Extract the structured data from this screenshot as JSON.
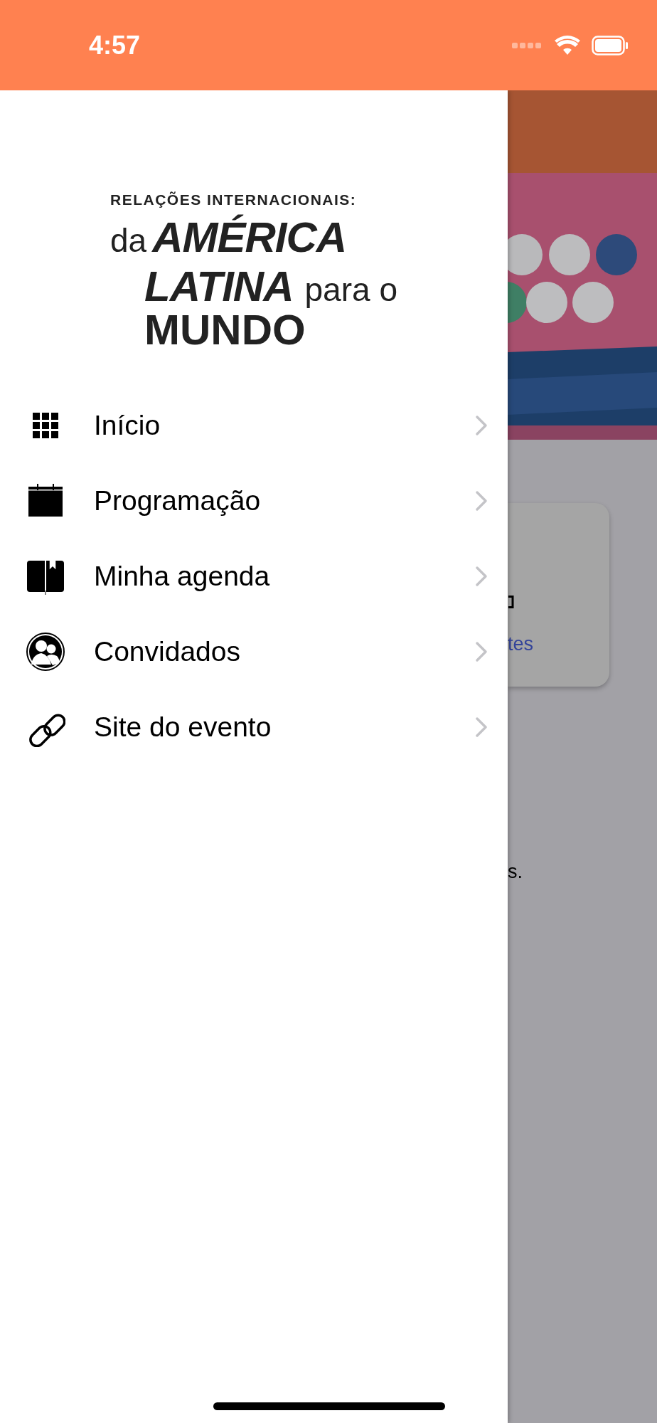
{
  "status_bar": {
    "time": "4:57"
  },
  "drawer": {
    "logo": {
      "line_1": "RELAÇÕES INTERNACIONAIS:",
      "line_2_prefix": "da",
      "line_2": "AMÉRICA",
      "line_3": "LATINA",
      "line_3_suffix": "para o",
      "line_4": "MUNDO"
    },
    "menu": [
      {
        "label": "Início",
        "kind": "grid"
      },
      {
        "label": "Programação",
        "kind": "calendar"
      },
      {
        "label": "Minha agenda",
        "kind": "book"
      },
      {
        "label": "Convidados",
        "kind": "people"
      },
      {
        "label": "Site do evento",
        "kind": "link"
      }
    ]
  },
  "background": {
    "link_fragment": "tes",
    "text_fragment": "s."
  }
}
